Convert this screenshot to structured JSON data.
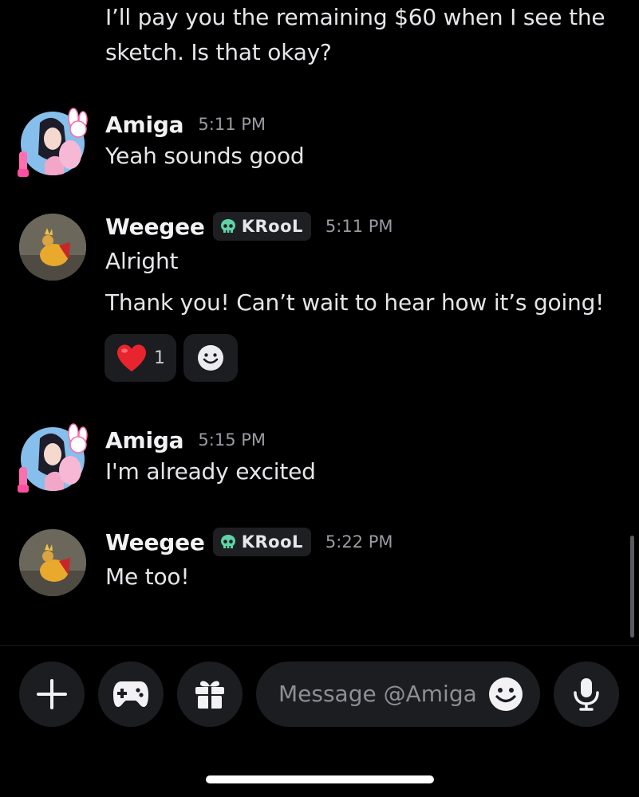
{
  "messages": [
    {
      "type": "continuation",
      "lines": [
        "I’ll pay you the remaining $60 when I see the",
        "sketch. Is that okay?"
      ]
    },
    {
      "author": "Amiga",
      "time": "5:11 PM",
      "lines": [
        "Yeah sounds good"
      ]
    },
    {
      "author": "Weegee",
      "tag": "KRooL",
      "time": "5:11 PM",
      "lines": [
        "Alright",
        "Thank you! Can’t wait to hear how it’s going!"
      ],
      "reactions": [
        {
          "emoji": "heart",
          "count": "1"
        }
      ]
    },
    {
      "author": "Amiga",
      "time": "5:15 PM",
      "lines": [
        "I'm already excited"
      ]
    },
    {
      "author": "Weegee",
      "tag": "KRooL",
      "time": "5:22 PM",
      "lines": [
        "Me too!"
      ]
    }
  ],
  "composer": {
    "placeholder": "Message @Amiga"
  },
  "colors": {
    "background": "#000000",
    "button_bg": "#1c1d21",
    "tag_icon": "#5fd3a6",
    "heart": "#e8242f"
  },
  "icons": [
    "plus-icon",
    "gamepad-icon",
    "gift-icon",
    "emoji-icon",
    "microphone-icon",
    "skull-icon",
    "heart-emoji",
    "add-reaction-icon"
  ]
}
